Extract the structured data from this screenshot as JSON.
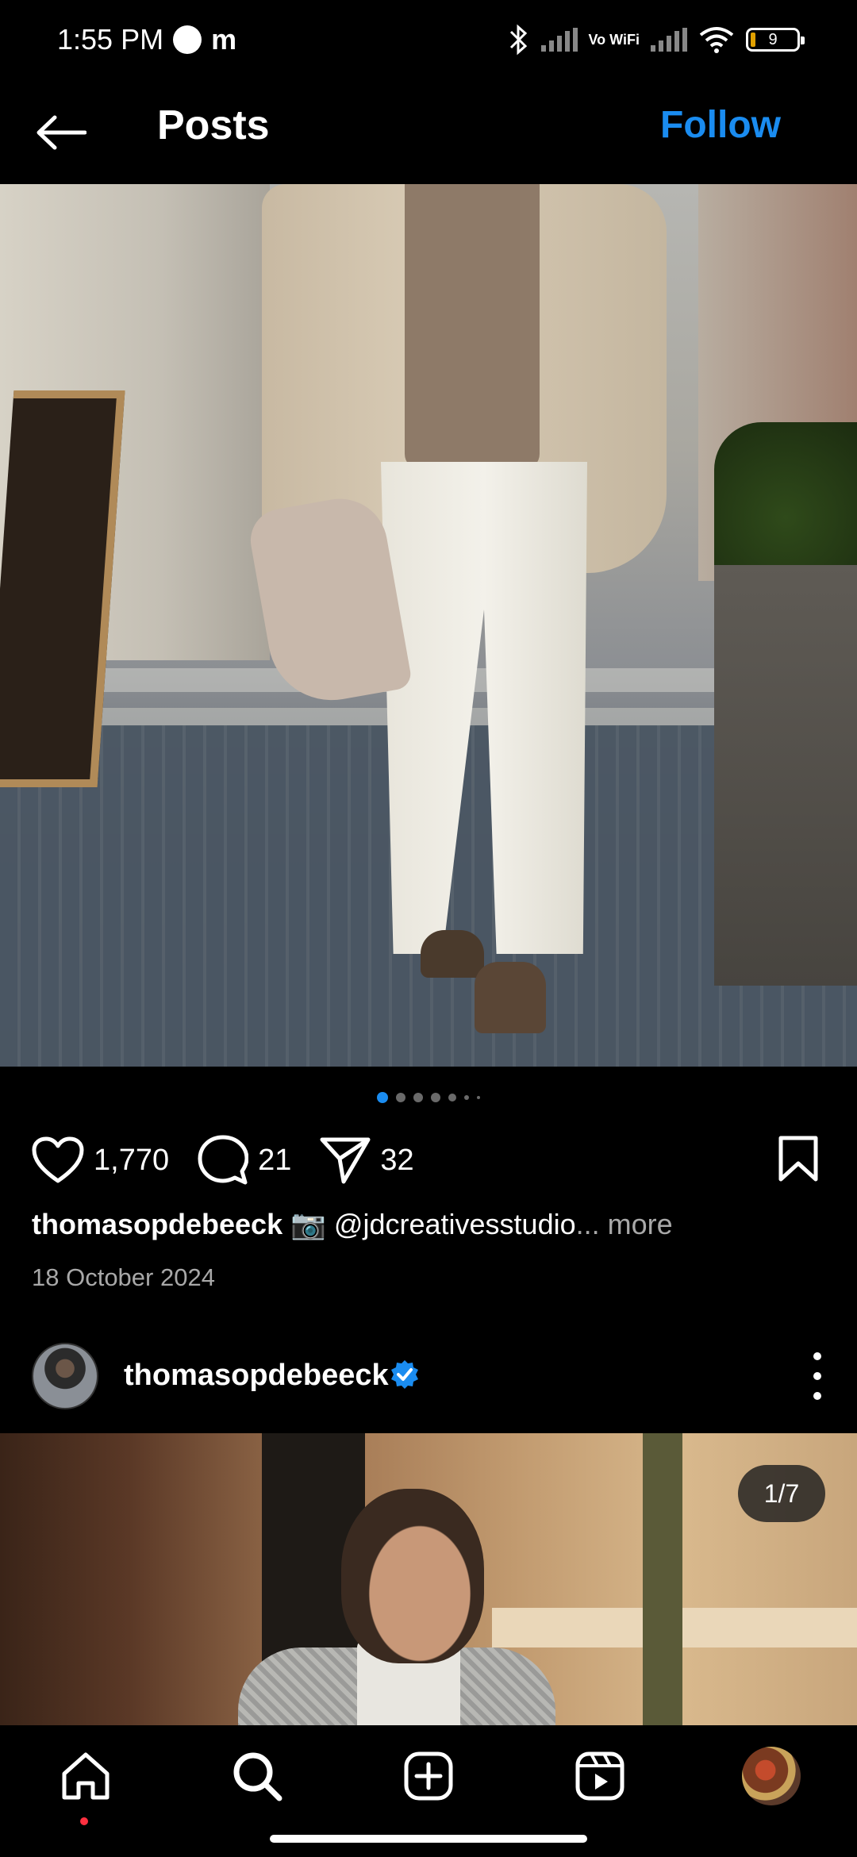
{
  "status_bar": {
    "time": "1:55 PM",
    "carrier_icon": "m",
    "vowifi": "Vo WiFi",
    "battery": "9"
  },
  "header": {
    "title": "Posts",
    "follow_label": "Follow",
    "back_icon": "arrow-left-icon"
  },
  "post1": {
    "carousel_dots": 6,
    "active_dot": 0,
    "likes": "1,770",
    "comments": "21",
    "shares": "32",
    "caption_user": "thomasopdebeeck",
    "caption_text": "📷 @jdcreativesstudio",
    "caption_more": "... more",
    "date": "18 October 2024"
  },
  "post2": {
    "username": "thomasopdebeeck",
    "verified": true,
    "counter": "1/7"
  },
  "bottom_nav": {
    "items": [
      "home-icon",
      "search-icon",
      "create-icon",
      "reels-icon",
      "profile-avatar"
    ],
    "notification_color": "#ff3040"
  },
  "colors": {
    "accent": "#1a8cf0",
    "secondary_text": "#a8a8a8"
  }
}
